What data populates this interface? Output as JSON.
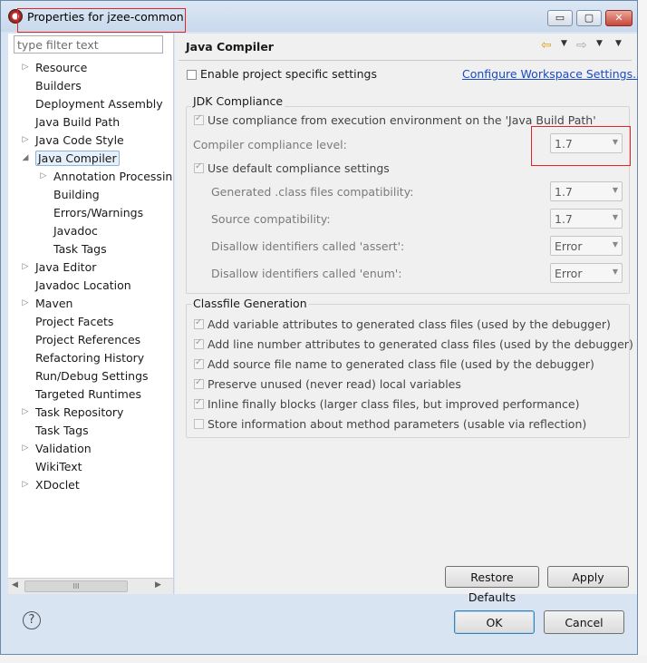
{
  "window": {
    "title": "Properties for jzee-common",
    "min_label": "▭",
    "max_label": "▢",
    "close_label": "✕"
  },
  "filter": {
    "placeholder": "type filter text"
  },
  "tree": [
    {
      "label": "Resource",
      "expandable": true
    },
    {
      "label": "Builders",
      "expandable": false
    },
    {
      "label": "Deployment Assembly",
      "expandable": false
    },
    {
      "label": "Java Build Path",
      "expandable": false
    },
    {
      "label": "Java Code Style",
      "expandable": true
    },
    {
      "label": "Java Compiler",
      "expandable": true,
      "expanded": true,
      "selected": true
    },
    {
      "label": "Annotation Processin",
      "expandable": true,
      "child": true
    },
    {
      "label": "Building",
      "expandable": false,
      "child": true
    },
    {
      "label": "Errors/Warnings",
      "expandable": false,
      "child": true
    },
    {
      "label": "Javadoc",
      "expandable": false,
      "child": true
    },
    {
      "label": "Task Tags",
      "expandable": false,
      "child": true
    },
    {
      "label": "Java Editor",
      "expandable": true
    },
    {
      "label": "Javadoc Location",
      "expandable": false
    },
    {
      "label": "Maven",
      "expandable": true
    },
    {
      "label": "Project Facets",
      "expandable": false
    },
    {
      "label": "Project References",
      "expandable": false
    },
    {
      "label": "Refactoring History",
      "expandable": false
    },
    {
      "label": "Run/Debug Settings",
      "expandable": false
    },
    {
      "label": "Targeted Runtimes",
      "expandable": false
    },
    {
      "label": "Task Repository",
      "expandable": true
    },
    {
      "label": "Task Tags",
      "expandable": false
    },
    {
      "label": "Validation",
      "expandable": true
    },
    {
      "label": "WikiText",
      "expandable": false
    },
    {
      "label": "XDoclet",
      "expandable": true
    }
  ],
  "page": {
    "title": "Java Compiler",
    "enable_label": "Enable project specific settings",
    "configure_link": "Configure Workspace Settings...",
    "jdk": {
      "legend": "JDK Compliance",
      "use_exec_env": "Use compliance from execution environment on the 'Java Build Path'",
      "compliance_level_label": "Compiler compliance level:",
      "compliance_level_value": "1.7",
      "use_default": "Use default compliance settings",
      "generated_label": "Generated .class files compatibility:",
      "generated_value": "1.7",
      "source_label": "Source compatibility:",
      "source_value": "1.7",
      "assert_label": "Disallow identifiers called 'assert':",
      "assert_value": "Error",
      "enum_label": "Disallow identifiers called 'enum':",
      "enum_value": "Error"
    },
    "classfile": {
      "legend": "Classfile Generation",
      "options": [
        {
          "label": "Add variable attributes to generated class files (used by the debugger)",
          "checked": true
        },
        {
          "label": "Add line number attributes to generated class files (used by the debugger)",
          "checked": true
        },
        {
          "label": "Add source file name to generated class file (used by the debugger)",
          "checked": true
        },
        {
          "label": "Preserve unused (never read) local variables",
          "checked": true
        },
        {
          "label": "Inline finally blocks (larger class files, but improved performance)",
          "checked": true
        },
        {
          "label": "Store information about method parameters (usable via reflection)",
          "checked": false
        }
      ]
    },
    "restore_defaults": "Restore Defaults",
    "apply": "Apply"
  },
  "footer": {
    "help": "?",
    "ok": "OK",
    "cancel": "Cancel"
  },
  "scrollbar": {
    "thumb": "III"
  }
}
